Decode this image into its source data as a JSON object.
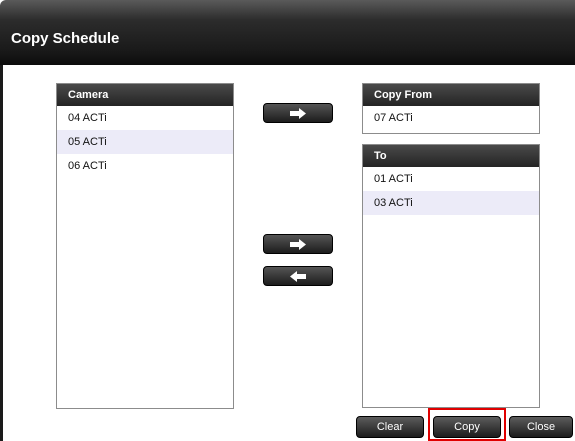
{
  "dialog": {
    "title": "Copy Schedule"
  },
  "camera_panel": {
    "header": "Camera",
    "items": [
      {
        "label": "04 ACTi",
        "selected": false
      },
      {
        "label": "05 ACTi",
        "selected": true
      },
      {
        "label": "06 ACTi",
        "selected": false
      }
    ]
  },
  "copy_from_panel": {
    "header": "Copy From",
    "items": [
      {
        "label": "07 ACTi"
      }
    ]
  },
  "to_panel": {
    "header": "To",
    "items": [
      {
        "label": "01 ACTi",
        "selected": false
      },
      {
        "label": "03 ACTi",
        "selected": true
      }
    ]
  },
  "buttons": {
    "clear": "Clear",
    "copy": "Copy",
    "close": "Close"
  },
  "icons": {
    "move_to_copy_from": "arrow-right-icon",
    "move_to_to": "arrow-right-icon",
    "move_back": "arrow-left-icon"
  },
  "colors": {
    "titlebar": "#1a1a1a",
    "panel_header": "#2e2e2e",
    "selected_row": "#ecebf8",
    "highlight": "#e00000"
  }
}
